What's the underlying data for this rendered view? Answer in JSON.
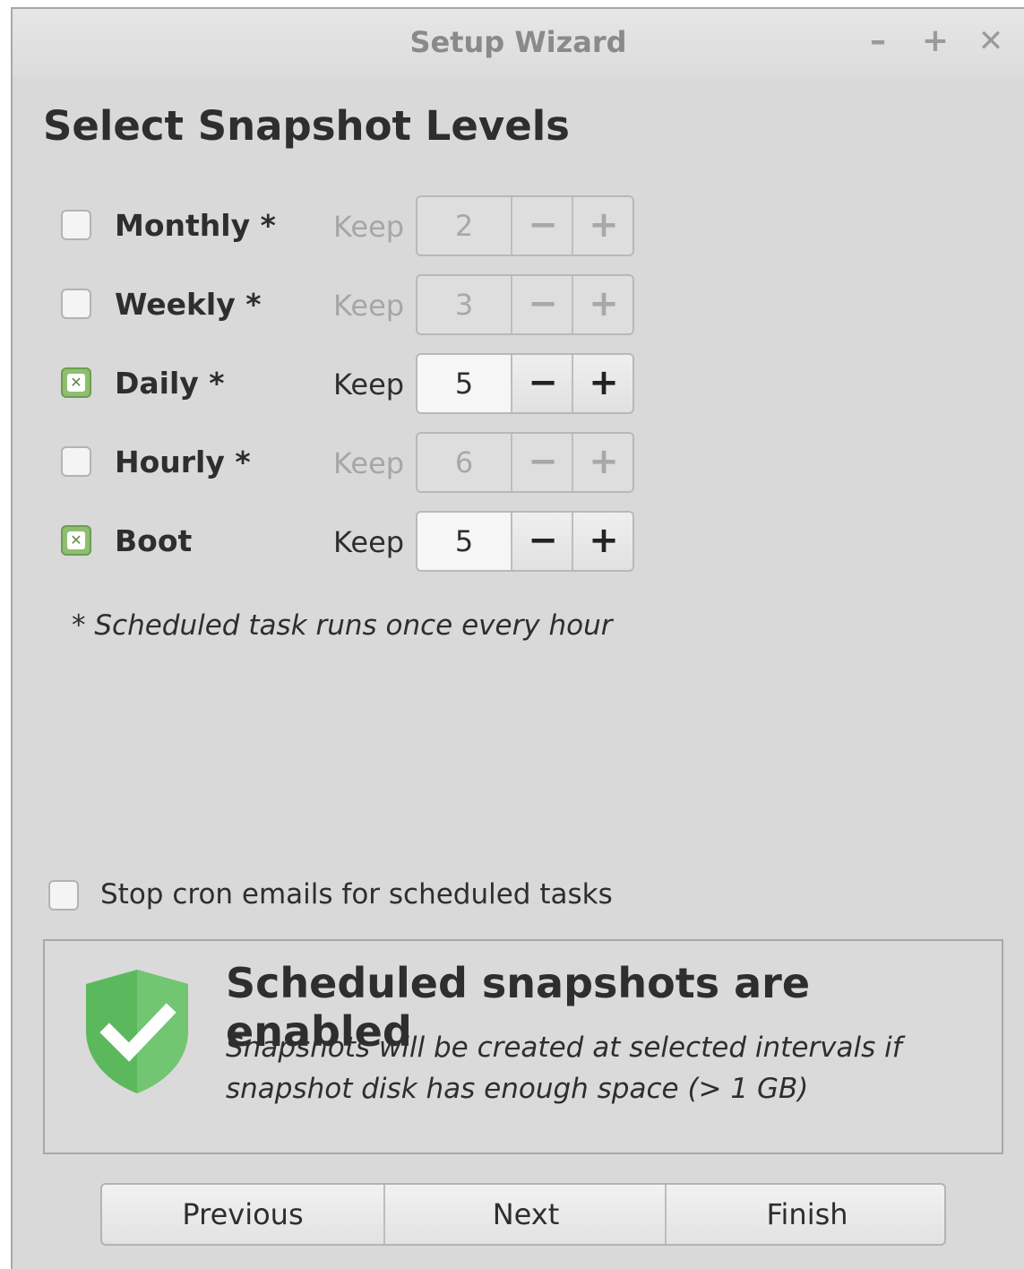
{
  "window": {
    "title": "Setup Wizard",
    "minimize_glyph": "–",
    "maximize_glyph": "+",
    "close_glyph": "✕"
  },
  "page": {
    "heading": "Select Snapshot Levels"
  },
  "levels": [
    {
      "label": "Monthly *",
      "checked": false,
      "keep_label": "Keep",
      "value": "2"
    },
    {
      "label": "Weekly *",
      "checked": false,
      "keep_label": "Keep",
      "value": "3"
    },
    {
      "label": "Daily *",
      "checked": true,
      "keep_label": "Keep",
      "value": "5"
    },
    {
      "label": "Hourly *",
      "checked": false,
      "keep_label": "Keep",
      "value": "6"
    },
    {
      "label": "Boot",
      "checked": true,
      "keep_label": "Keep",
      "value": "5"
    }
  ],
  "spin_glyphs": {
    "decrement": "−",
    "increment": "+"
  },
  "note": "* Scheduled task runs once every hour",
  "cron": {
    "label": "Stop cron emails for scheduled tasks",
    "checked": false
  },
  "status": {
    "icon": "shield-check-icon",
    "title": "Scheduled snapshots are enabled",
    "description": "Snapshots will be created at selected intervals if snapshot disk has enough space (> 1 GB)"
  },
  "nav": {
    "previous": "Previous",
    "next": "Next",
    "finish": "Finish"
  },
  "colors": {
    "shield_green": "#6cc26c",
    "check_green": "#8ebf6f"
  }
}
